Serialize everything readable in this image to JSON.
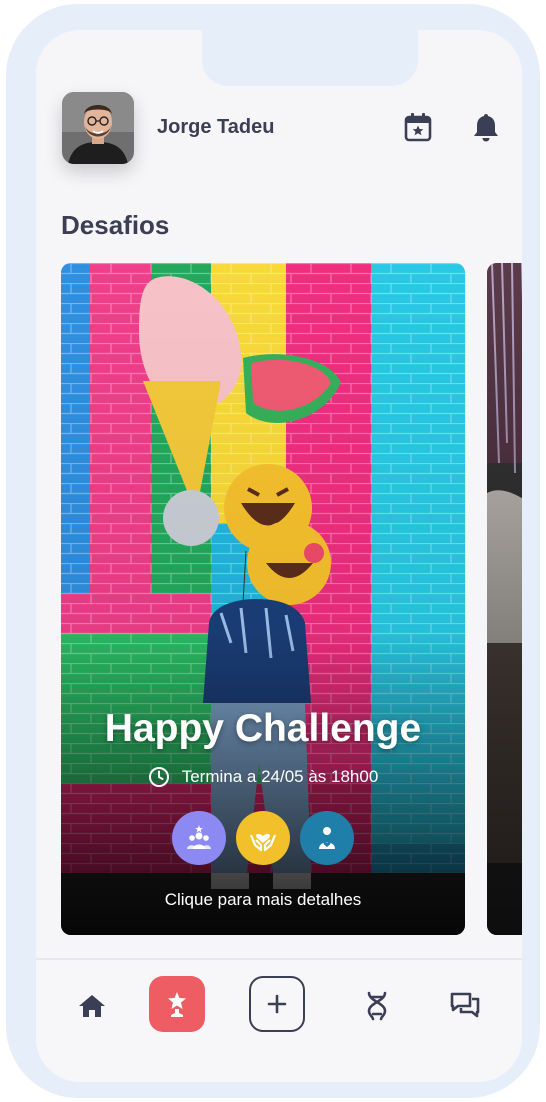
{
  "user": {
    "name": "Jorge Tadeu"
  },
  "header": {
    "calendar_icon": "calendar-star-icon",
    "notifications_icon": "bell-icon"
  },
  "section": {
    "title": "Desafios"
  },
  "challenge": {
    "title": "Happy Challenge",
    "deadline": "Termina a 24/05 às 18h00",
    "cta": "Clique para mais detalhes",
    "badges": [
      {
        "icon": "people-star-icon",
        "color": "#8c8af2"
      },
      {
        "icon": "hands-heart-icon",
        "color": "#f2c02a"
      },
      {
        "icon": "person-heart-icon",
        "color": "#1f7fa8"
      }
    ]
  },
  "bottom_nav": {
    "items": [
      "home-icon",
      "challenges-star-icon",
      "add-icon",
      "dna-icon",
      "chat-icon"
    ],
    "active": "challenges-star-icon",
    "accent": "#ee5d63"
  },
  "colors": {
    "text": "#3a3f55",
    "background": "#f6f6f9",
    "frame": "#e6eef9"
  }
}
